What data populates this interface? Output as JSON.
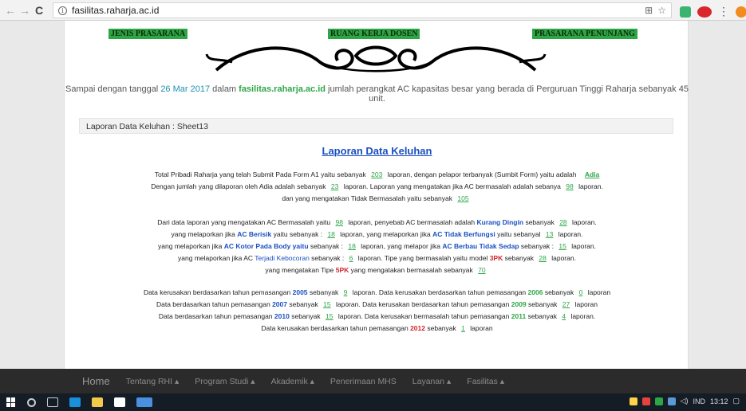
{
  "browser": {
    "url": "fasilitas.raharja.ac.id"
  },
  "header": {
    "labels": [
      "JENIS PRASARANA",
      "RUANG KERJA DOSEN",
      "PRASARANA PENUNJANG"
    ]
  },
  "intro": {
    "t1": "Sampai dengan tanggal ",
    "date": "26 Mar 2017",
    "t2": " dalam ",
    "site": "fasilitas.raharja.ac.id",
    "t3": " jumlah perangkat AC kapasitas besar yang berada di Perguruan Tinggi Raharja sebanyak 45 unit."
  },
  "section": {
    "label": "Laporan Data Keluhan : Sheet13"
  },
  "report": {
    "title": "Laporan Data Keluhan",
    "p1": {
      "l1a": "Total Pribadi Raharja yang telah Submit Pada Form A1 yaitu sebanyak",
      "n1": "203",
      "l1b": "laporan, dengan pelapor terbanyak (Sumbit Form) yaitu adalah",
      "name": "Adia",
      "l2a": "Dengan jumlah yang dilaporan oleh Adia adalah sebanyak",
      "n2": "23",
      "l2b": "laporan. Laporan yang mengatakan jika AC bermasalah adalah sebanya",
      "n3": "98",
      "l2c": "laporan.",
      "l3a": "dan yang mengatakan Tidak Bermasalah yaitu sebanyak",
      "n4": "105"
    },
    "p2": {
      "a1": "Dari data laporan yang mengatakan AC Bermasalah yaitu",
      "n1": "98",
      "a2": "laporan, penyebab AC bermasalah adalah",
      "c1": "Kurang Dingin",
      "a3": "sebanyak",
      "n2": "28",
      "a4": "laporan.",
      "b1": "yang melaporkan jika",
      "c2": "AC Berisik",
      "b2": "yaitu sebanyak :",
      "n3": "18",
      "b3": "laporan, yang melaporkan jika",
      "c3": "AC Tidak Berfungsi",
      "b4": "yaitu sebanyal",
      "n4": "13",
      "b5": "laporan.",
      "d1": "yang melaporkan jika",
      "c4": "AC Kotor Pada Body yaitu",
      "d2": "sebanyak :",
      "n5": "18",
      "d3": "laporan, yang melapor jika",
      "c5": "AC Berbau Tidak Sedap",
      "d4": "sebanyak :",
      "n6": "15",
      "d5": "laporan.",
      "e1": "yang melaporkan jika AC",
      "c6": "Terjadi Kebocoran",
      "e2": "sebanyak :",
      "n7": "6",
      "e3": "laporan. Tipe yang bermasalah yaitu model",
      "m1": "3PK",
      "e4": "sebanyak",
      "n8": "28",
      "e5": "laporan.",
      "f1": "yang mengatakan Tipe",
      "m2": "5PK",
      "f2": "yang mengatakan bermasalah sebanyak",
      "n9": "70"
    },
    "p3": {
      "a1": "Data kerusakan berdasarkan tahun pemasangan",
      "y1": "2005",
      "a2": "sebanyak",
      "n1": "9",
      "a3": "laporan. Data kerusakan berdasarkan tahun pemasangan",
      "y2": "2006",
      "a4": "sebanyak",
      "n2": "0",
      "a5": "laporan",
      "b1": "Data berdasarkan tahun pemasangan",
      "y3": "2007",
      "b2": "sebanyak",
      "n3": "15",
      "b3": "laporan. Data kerusakan berdasarkan tahun pemasangan",
      "y4": "2009",
      "b4": "sebanyak",
      "n4": "27",
      "b5": "laporan",
      "c1": "Data berdasarkan tahun pemasangan",
      "y5": "2010",
      "c2": "sebanyak",
      "n5": "15",
      "c3": "laporan. Data kerusakan bermasalah tahun pemasangan",
      "y6": "2011",
      "c4": "sebanyak",
      "n6": "4",
      "c5": "laporan.",
      "d1": "Data kerusakan berdasarkan tahun pemasangan",
      "y7": "2012",
      "d2": "sebanyak",
      "n7": "1",
      "d3": "laporan"
    }
  },
  "site_nav": {
    "home": "Home",
    "items": [
      "Tentang RHI",
      "Program Studi",
      "Akademik",
      "Penerimaan MHS",
      "Layanan",
      "Fasilitas"
    ]
  },
  "taskbar": {
    "lang": "IND",
    "time": "13:12"
  }
}
